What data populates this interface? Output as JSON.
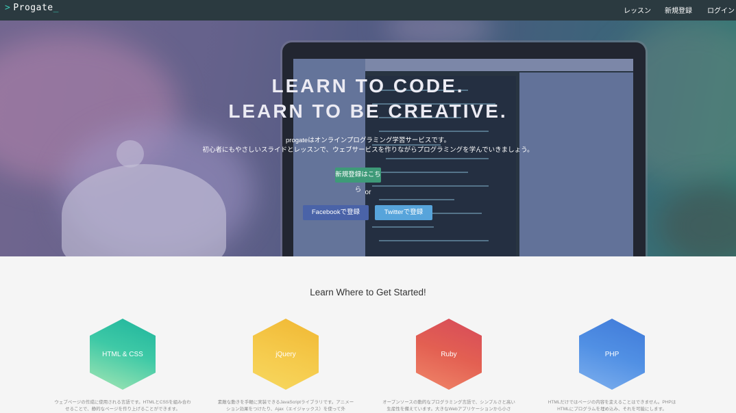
{
  "nav": {
    "logo": "Progate",
    "links": [
      "レッスン",
      "新規登録",
      "ログイン"
    ]
  },
  "hero": {
    "headline1": "LEARN TO CODE.",
    "headline2": "LEARN TO BE CREATIVE.",
    "desc1": "progateはオンラインプログラミング学習サービスです。",
    "desc2": "初心者にもやさしいスライドとレッスンで、ウェブサービスを作りながらプログラミングを学んでいきましょう。",
    "signup": "新規登録はこちら",
    "or": "or",
    "facebook": "Facebookで登録",
    "twitter": "Twitterで登録"
  },
  "courses_section": {
    "title": "Learn Where to Get Started!",
    "courses": [
      {
        "name": "HTML & CSS",
        "desc": "ウェブページの作成に使用される言語です。HTMLとCSSを組み合わせることで、静的なページを作り上げることができます。",
        "color": "#1fb49c"
      },
      {
        "name": "jQuery",
        "desc": "素敵な動きを手軽に実装できるJavaScriptライブラリです。アニメーション効果をつけたり、Ajax（エイジャックス）を使って外",
        "color": "#f0b733"
      },
      {
        "name": "Ruby",
        "desc": "オープンソースの動的なプログラミング言語で、シンプルさと高い生産性を備えています。大きなWebアプリケーションから小さ",
        "color": "#d64a5a"
      },
      {
        "name": "PHP",
        "desc": "HTMLだけではページの内容を変えることはできません。PHPはHTMLにプログラムを埋め込み、それを可能にします。",
        "color": "#3f79d8"
      }
    ]
  }
}
